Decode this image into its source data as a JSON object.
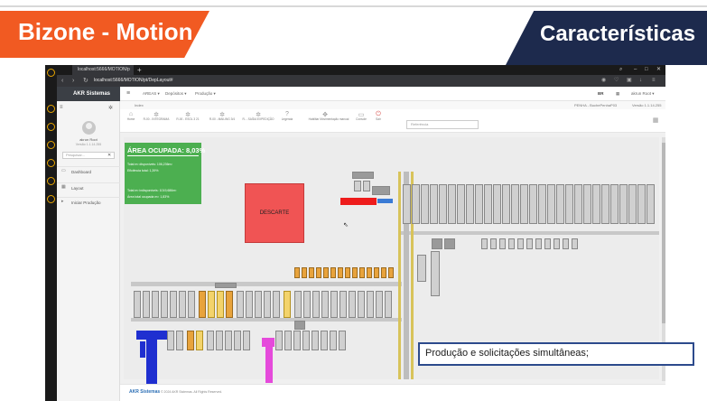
{
  "slide": {
    "left_title": "Bizone - Motion",
    "right_title": "Características",
    "caption": "Produção e solicitações simultâneas;",
    "colors": {
      "orange": "#f15a22",
      "navy": "#1d2a4d"
    }
  },
  "browser": {
    "tab_title": "localhost:5666/MOTION/p",
    "url": "localhost:5666/MOTION/pt/DepLayout#"
  },
  "sidebar": {
    "brand": "AKR Sistemas",
    "user_name": "akrun Root",
    "user_version": "Versão 1.1.14.255",
    "search_placeholder": "Pesquisar...",
    "items": [
      {
        "label": "Dashboard",
        "icon": "monitor-icon"
      },
      {
        "label": "Layout",
        "icon": "layout-icon"
      },
      {
        "label": "Iniciar Produção",
        "icon": "play-icon"
      }
    ]
  },
  "topnav": {
    "items": [
      "AREAS ▾",
      "Depósitos ▾",
      "Produção ▾"
    ],
    "lang": "BR",
    "user": "akrun Root ▾"
  },
  "breadcrumb": {
    "label": "Index",
    "right_user": "PENHA - BuchePenhaP03",
    "right_version": "Versão 1.1.14.255"
  },
  "toolbar": {
    "tools": [
      {
        "label": "Home",
        "icon": "home-icon"
      },
      {
        "label": "R-00 - INTEGRAMA",
        "icon": "gear-icon"
      },
      {
        "label": "R-00 - ESOL 3 21",
        "icon": "gear-icon"
      },
      {
        "label": "R-00 - MAILING 3/4",
        "icon": "gear-icon"
      },
      {
        "label": "R- - SAÍDA EXPEDIÇÃO",
        "icon": "gear-icon"
      },
      {
        "label": "Legenda",
        "icon": "help-icon"
      },
      {
        "label": "Habilitar Movimentação manual",
        "icon": "move-icon"
      },
      {
        "label": "Console",
        "icon": "console-icon"
      },
      {
        "label": "Sair",
        "icon": "logout-icon"
      }
    ],
    "reference_placeholder": "Referência"
  },
  "occupancy": {
    "title": "ÁREA OCUPADA: 8,03%",
    "line1": "Total m² disponíveis: 106,236m²",
    "line2": "Eficiência total: 1,39%",
    "line3": "Total m² indisponíveis: 1019,686m²",
    "line4": "Área total ocupada m²: 1,83%"
  },
  "layout": {
    "discard_label": "DESCARTE"
  },
  "footer": {
    "brand": "AKR Sistemas",
    "copyright": "© 2024 AKR Sistemas. All Rights Reserved."
  }
}
